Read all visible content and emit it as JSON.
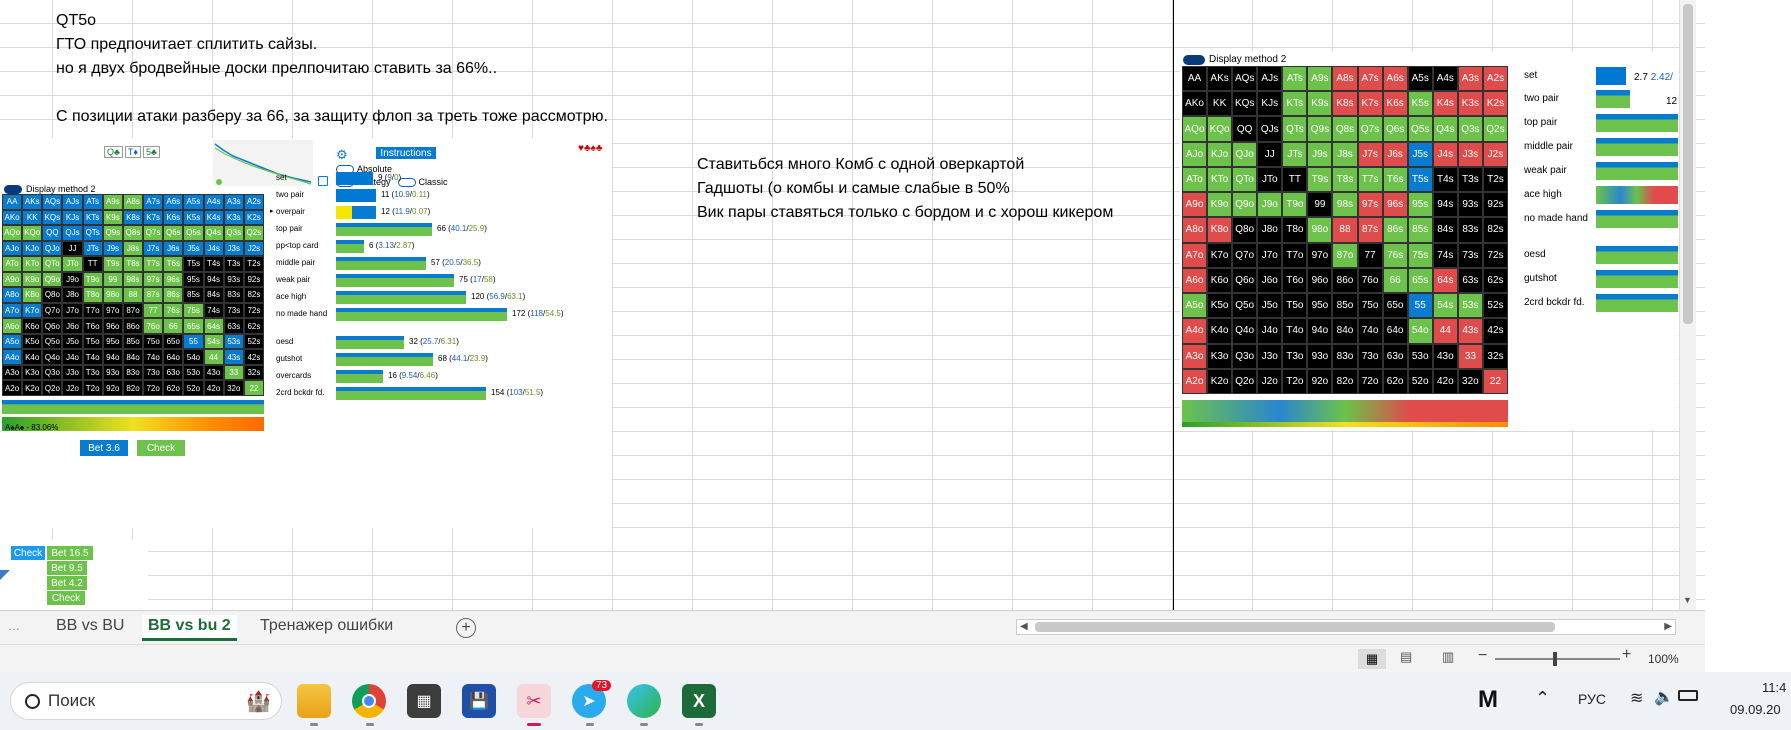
{
  "sheet": {
    "lines": [
      "QT5o",
      "ГТО предпочитает сплитить сайзы.",
      "но я двух бродвейные доски прелпочитаю ставить за 66%..",
      "С позиции атаки разберу за 66, за защиту флоп за треть тоже рассмотрю."
    ],
    "notes": [
      "Ставитьбся много  Комб с одной оверкартой",
      "Гадшоты (о комбы и самые слабые в 50%",
      "Вик пары ставяться только с бордом и с хорош кикером"
    ]
  },
  "left_panel": {
    "board": [
      "Q♣",
      "T♦",
      "5♣"
    ],
    "instructions_label": "Instructions",
    "toggle_absolute": "Absolute",
    "toggle_strategy": "Strategy",
    "toggle_classic": "Classic",
    "display_method": "Display method 2",
    "suits": "♥♣♠♣",
    "equity_label": "A♠A♠ - 83.06%",
    "bet_button": "Bet 3.6",
    "check_button": "Check",
    "categories": [
      {
        "name": "set",
        "total": "9",
        "a": "9",
        "b": "0"
      },
      {
        "name": "two pair",
        "total": "11",
        "a": "10.9",
        "b": "0.11"
      },
      {
        "name": "overpair",
        "total": "12",
        "a": "11.9",
        "b": "0.07"
      },
      {
        "name": "top pair",
        "total": "66",
        "a": "40.1",
        "b": "25.9"
      },
      {
        "name": "pp<top card",
        "total": "6",
        "a": "3.13",
        "b": "2.87"
      },
      {
        "name": "middle pair",
        "total": "57",
        "a": "20.5",
        "b": "36.5"
      },
      {
        "name": "weak pair",
        "total": "75",
        "a": "17",
        "b": "58"
      },
      {
        "name": "ace high",
        "total": "120",
        "a": "56.9",
        "b": "63.1"
      },
      {
        "name": "no made hand",
        "total": "172",
        "a": "118",
        "b": "54.5"
      },
      {
        "name": "oesd",
        "total": "32",
        "a": "25.7",
        "b": "6.31"
      },
      {
        "name": "gutshot",
        "total": "68",
        "a": "44.1",
        "b": "23.9"
      },
      {
        "name": "overcards",
        "total": "16",
        "a": "9.54",
        "b": "6.46"
      },
      {
        "name": "2crd bckdr fd.",
        "total": "154",
        "a": "103",
        "b": "51.5"
      }
    ]
  },
  "small_actions": [
    "Check",
    "Bet 16.5",
    "Bet 9.5",
    "Bet 4.2",
    "Check"
  ],
  "right_panel": {
    "display_method": "Display method 2",
    "categories": [
      "set",
      "two pair",
      "top pair",
      "middle pair",
      "weak pair",
      "ace high",
      "no made hand",
      "oesd",
      "gutshot",
      "2crd bckdr fd."
    ],
    "set_value": "2.7",
    "set_value2": "2.42/",
    "two_pair_value": "12"
  },
  "matrix": [
    [
      "AA",
      "AKs",
      "AQs",
      "AJs",
      "ATs",
      "A9s",
      "A8s",
      "A7s",
      "A6s",
      "A5s",
      "A4s",
      "A3s",
      "A2s"
    ],
    [
      "AKo",
      "KK",
      "KQs",
      "KJs",
      "KTs",
      "K9s",
      "K8s",
      "K7s",
      "K6s",
      "K5s",
      "K4s",
      "K3s",
      "K2s"
    ],
    [
      "AQo",
      "KQo",
      "QQ",
      "QJs",
      "QTs",
      "Q9s",
      "Q8s",
      "Q7s",
      "Q6s",
      "Q5s",
      "Q4s",
      "Q3s",
      "Q2s"
    ],
    [
      "AJo",
      "KJo",
      "QJo",
      "JJ",
      "JTs",
      "J9s",
      "J8s",
      "J7s",
      "J6s",
      "J5s",
      "J4s",
      "J3s",
      "J2s"
    ],
    [
      "ATo",
      "KTo",
      "QTo",
      "JTo",
      "TT",
      "T9s",
      "T8s",
      "T7s",
      "T6s",
      "T5s",
      "T4s",
      "T3s",
      "T2s"
    ],
    [
      "A9o",
      "K9o",
      "Q9o",
      "J9o",
      "T9o",
      "99",
      "98s",
      "97s",
      "96s",
      "95s",
      "94s",
      "93s",
      "92s"
    ],
    [
      "A8o",
      "K8o",
      "Q8o",
      "J8o",
      "T8o",
      "98o",
      "88",
      "87s",
      "86s",
      "85s",
      "84s",
      "83s",
      "82s"
    ],
    [
      "A7o",
      "K7o",
      "Q7o",
      "J7o",
      "T7o",
      "97o",
      "87o",
      "77",
      "76s",
      "75s",
      "74s",
      "73s",
      "72s"
    ],
    [
      "A6o",
      "K6o",
      "Q6o",
      "J6o",
      "T6o",
      "96o",
      "86o",
      "76o",
      "66",
      "65s",
      "64s",
      "63s",
      "62s"
    ],
    [
      "A5o",
      "K5o",
      "Q5o",
      "J5o",
      "T5o",
      "95o",
      "85o",
      "75o",
      "65o",
      "55",
      "54s",
      "53s",
      "52s"
    ],
    [
      "A4o",
      "K4o",
      "Q4o",
      "J4o",
      "T4o",
      "94o",
      "84o",
      "74o",
      "64o",
      "54o",
      "44",
      "43s",
      "42s"
    ],
    [
      "A3o",
      "K3o",
      "Q3o",
      "J3o",
      "T3o",
      "93o",
      "83o",
      "73o",
      "63o",
      "53o",
      "43o",
      "33",
      "32s"
    ],
    [
      "A2o",
      "K2o",
      "Q2o",
      "J2o",
      "T2o",
      "92o",
      "82o",
      "72o",
      "62o",
      "52o",
      "42o",
      "32o",
      "22"
    ]
  ],
  "left_colors": [
    [
      "b",
      "b",
      "b",
      "b",
      "b",
      "g",
      "g",
      "b",
      "b",
      "b",
      "b",
      "b",
      "b"
    ],
    [
      "b",
      "b",
      "b",
      "b",
      "b",
      "g",
      "b",
      "b",
      "b",
      "b",
      "b",
      "b",
      "b"
    ],
    [
      "g",
      "g",
      "b",
      "b",
      "b",
      "g",
      "g",
      "g",
      "g",
      "g",
      "g",
      "g",
      "g"
    ],
    [
      "b",
      "b",
      "b",
      "k",
      "b",
      "b",
      "g",
      "b",
      "b",
      "b",
      "b",
      "b",
      "b"
    ],
    [
      "g",
      "g",
      "g",
      "g",
      "k",
      "g",
      "g",
      "g",
      "g",
      "k",
      "k",
      "k",
      "k"
    ],
    [
      "g",
      "g",
      "g",
      "k",
      "g",
      "g",
      "g",
      "g",
      "g",
      "k",
      "k",
      "k",
      "k"
    ],
    [
      "b",
      "g",
      "k",
      "k",
      "g",
      "g",
      "g",
      "g",
      "g",
      "k",
      "k",
      "k",
      "k"
    ],
    [
      "b",
      "b",
      "k",
      "k",
      "k",
      "k",
      "k",
      "g",
      "g",
      "g",
      "k",
      "k",
      "k"
    ],
    [
      "g",
      "k",
      "k",
      "k",
      "k",
      "k",
      "k",
      "g",
      "g",
      "g",
      "g",
      "k",
      "k"
    ],
    [
      "b",
      "k",
      "k",
      "k",
      "k",
      "k",
      "k",
      "k",
      "k",
      "b",
      "g",
      "b",
      "k"
    ],
    [
      "b",
      "k",
      "k",
      "k",
      "k",
      "k",
      "k",
      "k",
      "k",
      "k",
      "g",
      "b",
      "k"
    ],
    [
      "k",
      "k",
      "k",
      "k",
      "k",
      "k",
      "k",
      "k",
      "k",
      "k",
      "k",
      "g",
      "k"
    ],
    [
      "k",
      "k",
      "k",
      "k",
      "k",
      "k",
      "k",
      "k",
      "k",
      "k",
      "k",
      "k",
      "g"
    ]
  ],
  "right_colors": [
    [
      "k",
      "k",
      "k",
      "k",
      "g",
      "g",
      "r",
      "r",
      "r",
      "k",
      "k",
      "r",
      "r"
    ],
    [
      "k",
      "k",
      "k",
      "k",
      "g",
      "g",
      "r",
      "r",
      "r",
      "g",
      "r",
      "r",
      "r"
    ],
    [
      "g",
      "g",
      "k",
      "k",
      "g",
      "g",
      "g",
      "g",
      "g",
      "g",
      "g",
      "g",
      "g"
    ],
    [
      "g",
      "g",
      "g",
      "k",
      "g",
      "g",
      "g",
      "r",
      "r",
      "b",
      "r",
      "r",
      "r"
    ],
    [
      "g",
      "g",
      "g",
      "k",
      "k",
      "g",
      "g",
      "g",
      "g",
      "b",
      "k",
      "k",
      "k"
    ],
    [
      "r",
      "g",
      "g",
      "g",
      "g",
      "k",
      "g",
      "r",
      "r",
      "g",
      "k",
      "k",
      "k"
    ],
    [
      "r",
      "r",
      "k",
      "k",
      "k",
      "g",
      "r",
      "r",
      "g",
      "g",
      "k",
      "k",
      "k"
    ],
    [
      "r",
      "k",
      "k",
      "k",
      "k",
      "k",
      "g",
      "k",
      "g",
      "g",
      "k",
      "k",
      "k"
    ],
    [
      "r",
      "k",
      "k",
      "k",
      "k",
      "k",
      "k",
      "k",
      "g",
      "g",
      "r",
      "k",
      "k"
    ],
    [
      "g",
      "k",
      "k",
      "k",
      "k",
      "k",
      "k",
      "k",
      "k",
      "b",
      "g",
      "g",
      "k"
    ],
    [
      "r",
      "k",
      "k",
      "k",
      "k",
      "k",
      "k",
      "k",
      "k",
      "g",
      "r",
      "r",
      "k"
    ],
    [
      "r",
      "k",
      "k",
      "k",
      "k",
      "k",
      "k",
      "k",
      "k",
      "k",
      "k",
      "r",
      "k"
    ],
    [
      "r",
      "k",
      "k",
      "k",
      "k",
      "k",
      "k",
      "k",
      "k",
      "k",
      "k",
      "k",
      "r"
    ]
  ],
  "tabs": [
    "BB vs BU",
    "BB vs bu 2",
    "Тренажер ошибки"
  ],
  "active_tab_index": 1,
  "status": {
    "zoom": "100%"
  },
  "taskbar": {
    "search_placeholder": "Поиск",
    "lang": "РУС",
    "time": "11:4",
    "date": "09.09.20",
    "telegram_badge": "73"
  },
  "colors": {
    "blue": "#0a7cd0",
    "green": "#6cc24a",
    "red": "#e04b4b",
    "black": "#000000",
    "excel_green": "#1e6b3a"
  }
}
